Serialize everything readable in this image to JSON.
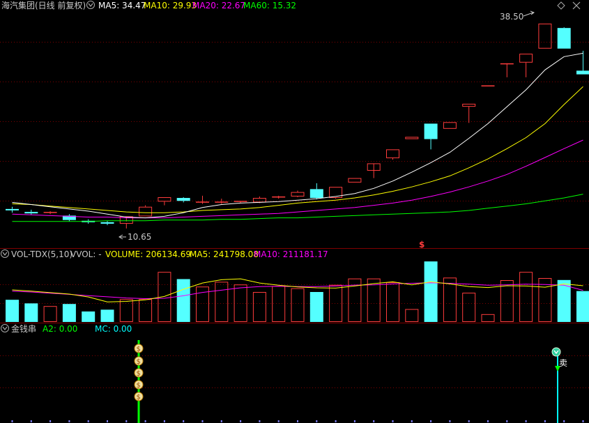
{
  "main_panel": {
    "title": "海汽集团(日线 前复权)",
    "ma_items": [
      {
        "label": "MA5: 34.47",
        "color": "#ffffff"
      },
      {
        "label": "MA10: 29.93",
        "color": "#ffff00"
      },
      {
        "label": "MA20: 22.67",
        "color": "#ff00ff"
      },
      {
        "label": "MA60: 15.32",
        "color": "#00ff00"
      }
    ],
    "high_label": "38.50",
    "low_label": "10.65",
    "sell_marker": "$"
  },
  "volume_panel": {
    "title": "VOL-TDX(5,10)",
    "items": [
      {
        "label": "VVOL: -",
        "color": "#c8c8c8"
      },
      {
        "label": "VOLUME: 206134.69",
        "color": "#ffff00"
      },
      {
        "label": "MA5: 241798.08",
        "color": "#ffff00"
      },
      {
        "label": "MA10: 211181.17",
        "color": "#ff00ff"
      }
    ]
  },
  "signal_panel": {
    "title": "金钱串",
    "items": [
      {
        "label": "A2: 0.00",
        "color": "#00ff00"
      },
      {
        "label": "MC: 0.00",
        "color": "#00ffff"
      }
    ],
    "buy_coin_glyph": "$",
    "sell_label": "卖"
  },
  "colors": {
    "up": "#ff3c3c",
    "down": "#54ffff",
    "grid": "#800000",
    "ma5": "#ffffff",
    "ma10": "#ffff00",
    "ma20": "#ff00ff",
    "ma60": "#00ff00"
  },
  "chart_data": [
    {
      "type": "candlestick",
      "y_range": [
        9.5,
        40
      ],
      "candles": [
        {
          "o": 13.3,
          "h": 13.6,
          "c": 13.2,
          "l": 12.8
        },
        {
          "o": 12.9,
          "h": 13.2,
          "c": 12.7,
          "l": 12.5
        },
        {
          "o": 12.8,
          "h": 13.0,
          "c": 12.9,
          "l": 12.6
        },
        {
          "o": 12.4,
          "h": 12.6,
          "c": 11.8,
          "l": 11.6
        },
        {
          "o": 11.7,
          "h": 11.9,
          "c": 11.5,
          "l": 11.3
        },
        {
          "o": 11.5,
          "h": 11.7,
          "c": 11.3,
          "l": 11.1
        },
        {
          "o": 11.3,
          "h": 11.6,
          "c": 12.3,
          "l": 10.65
        },
        {
          "o": 12.3,
          "h": 13.8,
          "c": 13.6,
          "l": 12.3
        },
        {
          "o": 14.3,
          "h": 14.9,
          "c": 14.9,
          "l": 13.8
        },
        {
          "o": 14.8,
          "h": 14.9,
          "c": 14.4,
          "l": 14.2
        },
        {
          "o": 14.3,
          "h": 15.1,
          "c": 14.3,
          "l": 14.0
        },
        {
          "o": 14.3,
          "h": 14.7,
          "c": 14.3,
          "l": 14.0
        },
        {
          "o": 14.3,
          "h": 14.4,
          "c": 14.4,
          "l": 14.1
        },
        {
          "o": 14.2,
          "h": 15.0,
          "c": 14.8,
          "l": 14.1
        },
        {
          "o": 14.9,
          "h": 15.1,
          "c": 15.0,
          "l": 14.7
        },
        {
          "o": 15.0,
          "h": 15.8,
          "c": 15.6,
          "l": 14.9
        },
        {
          "o": 16.0,
          "h": 16.8,
          "c": 14.8,
          "l": 14.6
        },
        {
          "o": 14.8,
          "h": 16.3,
          "c": 16.3,
          "l": 14.7
        },
        {
          "o": 16.9,
          "h": 17.5,
          "c": 17.5,
          "l": 16.9
        },
        {
          "o": 18.5,
          "h": 18.5,
          "c": 19.5,
          "l": 17.5
        },
        {
          "o": 20.2,
          "h": 21.4,
          "c": 21.4,
          "l": 20.0
        },
        {
          "o": 22.8,
          "h": 23.1,
          "c": 23.1,
          "l": 22.8
        },
        {
          "o": 24.9,
          "h": 24.9,
          "c": 22.8,
          "l": 21.4
        },
        {
          "o": 24.2,
          "h": 25.1,
          "c": 25.1,
          "l": 24.2
        },
        {
          "o": 27.2,
          "h": 27.6,
          "c": 27.6,
          "l": 25.0
        },
        {
          "o": 30.1,
          "h": 30.1,
          "c": 30.1,
          "l": 30.1
        },
        {
          "o": 33.1,
          "h": 33.1,
          "c": 33.1,
          "l": 31.2
        },
        {
          "o": 33.2,
          "h": 34.4,
          "c": 34.4,
          "l": 31.2
        },
        {
          "o": 35.1,
          "h": 38.5,
          "c": 38.5,
          "l": 35.1
        },
        {
          "o": 37.9,
          "h": 38.0,
          "c": 35.1,
          "l": 35.1
        },
        {
          "o": 32.1,
          "h": 34.8,
          "c": 31.6,
          "l": 31.6
        }
      ],
      "ma": {
        "ma5": [
          14.2,
          13.9,
          13.6,
          13.3,
          13.0,
          12.6,
          12.2,
          12.1,
          12.3,
          12.8,
          13.5,
          13.9,
          14.1,
          14.2,
          14.3,
          14.5,
          14.7,
          15.0,
          15.4,
          16.1,
          17.1,
          18.3,
          19.6,
          21.0,
          22.9,
          24.9,
          27.2,
          29.5,
          32.2,
          34.0,
          34.47
        ],
        "ma10": [
          14.0,
          13.9,
          13.7,
          13.5,
          13.3,
          13.1,
          12.9,
          12.8,
          12.8,
          12.9,
          13.1,
          13.2,
          13.3,
          13.5,
          13.8,
          14.1,
          14.3,
          14.5,
          14.8,
          15.2,
          15.7,
          16.3,
          17.0,
          17.8,
          18.9,
          20.1,
          21.5,
          23.0,
          24.9,
          27.5,
          29.93
        ],
        "ma20": [
          12.6,
          12.5,
          12.4,
          12.3,
          12.2,
          12.2,
          12.1,
          12.1,
          12.1,
          12.2,
          12.3,
          12.4,
          12.5,
          12.6,
          12.7,
          12.9,
          13.1,
          13.3,
          13.5,
          13.8,
          14.1,
          14.5,
          15.0,
          15.6,
          16.3,
          17.1,
          18.0,
          19.1,
          20.3,
          21.5,
          22.67
        ],
        "ma60": [
          11.6,
          11.6,
          11.6,
          11.6,
          11.6,
          11.7,
          11.7,
          11.7,
          11.8,
          11.8,
          11.8,
          11.9,
          11.9,
          12.0,
          12.1,
          12.1,
          12.2,
          12.3,
          12.4,
          12.5,
          12.6,
          12.7,
          12.8,
          12.9,
          13.1,
          13.4,
          13.7,
          14.0,
          14.4,
          14.8,
          15.32
        ]
      }
    },
    {
      "type": "bar",
      "y_range": [
        0,
        400000
      ],
      "volumes": [
        148000,
        124000,
        106000,
        120000,
        70000,
        82000,
        152000,
        152000,
        334000,
        286000,
        236000,
        268000,
        250000,
        200000,
        240000,
        225000,
        200000,
        248000,
        290000,
        290000,
        265000,
        86000,
        404000,
        296000,
        195000,
        52000,
        279000,
        334000,
        293000,
        280000,
        206134.69
      ],
      "ma5": [
        214000,
        206000,
        196000,
        186000,
        167000,
        134000,
        137000,
        148000,
        170000,
        218000,
        260000,
        282000,
        288000,
        260000,
        245000,
        234000,
        228000,
        226000,
        240000,
        256000,
        268000,
        248000,
        268000,
        254000,
        236000,
        230000,
        242000,
        240000,
        232000,
        254000,
        241798
      ],
      "ma10": [
        206000,
        200000,
        192000,
        184000,
        176000,
        168000,
        160000,
        156000,
        158000,
        175000,
        197000,
        212000,
        228000,
        236000,
        238000,
        236000,
        236000,
        240000,
        246000,
        248000,
        254000,
        258000,
        262000,
        258000,
        252000,
        245000,
        248000,
        252000,
        250000,
        245000,
        211181
      ]
    }
  ]
}
